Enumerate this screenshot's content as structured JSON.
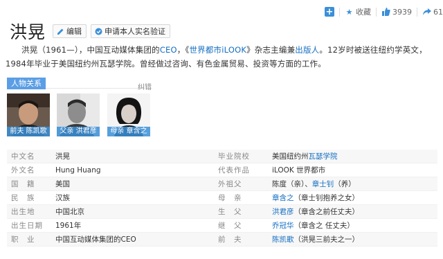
{
  "toolbar": {
    "add_icon": "plus-icon",
    "favorite_label": "收藏",
    "like_count": "3939",
    "share_count": "61"
  },
  "title": "洪晃",
  "buttons": {
    "edit": "编辑",
    "verify": "申请本人实名验证"
  },
  "summary": {
    "p1": "洪晃（1961—），中国互动媒体集团的",
    "ceo": "CEO",
    "p2": "，《",
    "magazine": "世界都市iLOOK",
    "p3": "》杂志主编兼",
    "publisher": "出版人",
    "p4": "。12岁时被送往纽约学英文，1984年毕业于美国纽约州瓦瑟学院。曾经做过咨询、有色金属贸易、投资等方面的工作。"
  },
  "relations": {
    "tab": "人物关系",
    "correct": "纠错",
    "people": [
      {
        "caption": "前夫 陈凯歌"
      },
      {
        "caption": "父亲 洪君彦"
      },
      {
        "caption": "母亲 章含之"
      }
    ]
  },
  "info": {
    "rows": [
      {
        "k1": "中文名",
        "v1": "洪晃",
        "k2": "毕业院校",
        "v2_pre": "美国纽约州",
        "v2_link": "瓦瑟学院",
        "v2_post": ""
      },
      {
        "k1": "外文名",
        "v1": "Hung Huang",
        "k2": "代表作品",
        "v2_pre": "iLOOK 世界都市",
        "v2_link": "",
        "v2_post": ""
      },
      {
        "k1": "国　籍",
        "v1": "美国",
        "k2": "外祖父",
        "v2_pre": "陈度（亲）、",
        "v2_link": "章士钊",
        "v2_post": "（养）"
      },
      {
        "k1": "民　族",
        "v1": "汉族",
        "k2": "母　亲",
        "v2_pre": "",
        "v2_link": "章含之",
        "v2_post": "（章士钊抱养之女）"
      },
      {
        "k1": "出生地",
        "v1": "中国北京",
        "k2": "生　父",
        "v2_pre": "",
        "v2_link": "洪君彦",
        "v2_post": "（章含之前任丈夫）"
      },
      {
        "k1": "出生日期",
        "v1": "1961年",
        "k2": "继　父",
        "v2_pre": "",
        "v2_link": "乔冠华",
        "v2_post": "（章含之 任丈夫）"
      },
      {
        "k1": "职　业",
        "v1": "中国互动媒体集团的CEO",
        "k2": "前　夫",
        "v2_pre": "",
        "v2_link": "陈凯歌",
        "v2_post": "（洪晃三前夫之一）"
      }
    ]
  },
  "colors": {
    "link": "#136ec2",
    "accent": "#5b9ee5"
  }
}
